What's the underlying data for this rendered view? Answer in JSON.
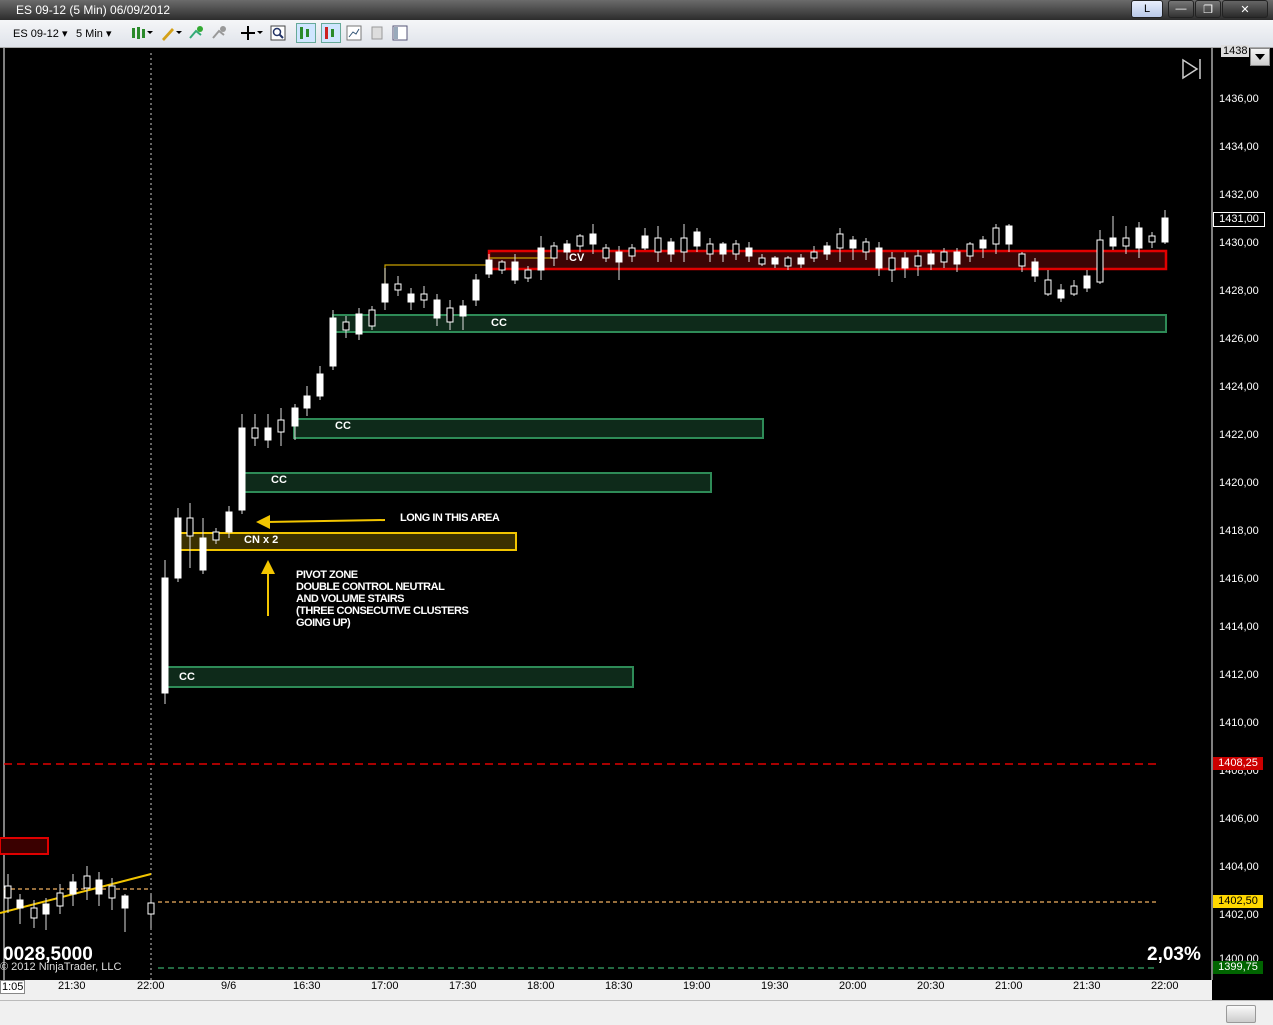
{
  "window": {
    "title": "ES 09-12 (5 Min)  06/09/2012",
    "btn_l": "L",
    "btn_min": "—",
    "btn_max": "❐",
    "btn_close": "✕"
  },
  "toolbar": {
    "instrument": "ES 09-12",
    "interval": "5 Min",
    "chevron": "▾"
  },
  "right_axis": {
    "top_label": "1438",
    "labels": [
      "1436,00",
      "1434,00",
      "1432,00",
      "1430,00",
      "1428,00",
      "1426,00",
      "1424,00",
      "1422,00",
      "1420,00",
      "1418,00",
      "1416,00",
      "1414,00",
      "1412,00",
      "1410,00",
      "1408,00",
      "1406,00",
      "1404,00",
      "1402,00"
    ],
    "last_price": "1431,00",
    "red_level": "1408,25",
    "yellow_level": "1402,50",
    "green_level": "1399,75",
    "bottom_partial": "1400,00"
  },
  "x_axis": {
    "labels": [
      "1:05",
      "21:30",
      "22:00",
      "9/6",
      "16:30",
      "17:00",
      "17:30",
      "18:00",
      "18:30",
      "19:00",
      "19:30",
      "20:00",
      "20:30",
      "21:00",
      "21:30",
      "22:00"
    ]
  },
  "zones": {
    "cc_1412": "CC",
    "cn": "CN x 2",
    "cc_1420": "CC",
    "cc_1422": "CC",
    "cc_1426": "CC",
    "cv": "CV"
  },
  "annotations": {
    "long": "LONG IN THIS AREA",
    "pivot_lines": [
      "PIVOT ZONE",
      "DOUBLE CONTROL NEUTRAL",
      "AND VOLUME STAIRS",
      "(THREE CONSECUTIVE CLUSTERS",
      "GOING UP)"
    ]
  },
  "readouts": {
    "left_value": "0028,5000",
    "right_percent": "2,03%",
    "copyright": "© 2012 NinjaTrader, LLC"
  },
  "colors": {
    "accent_red": "#e00000",
    "accent_green": "#2e8b57",
    "accent_yellow": "#f2c500",
    "label_red": "#cc0000",
    "label_yellow": "#ffd700",
    "label_green": "#006400"
  }
}
